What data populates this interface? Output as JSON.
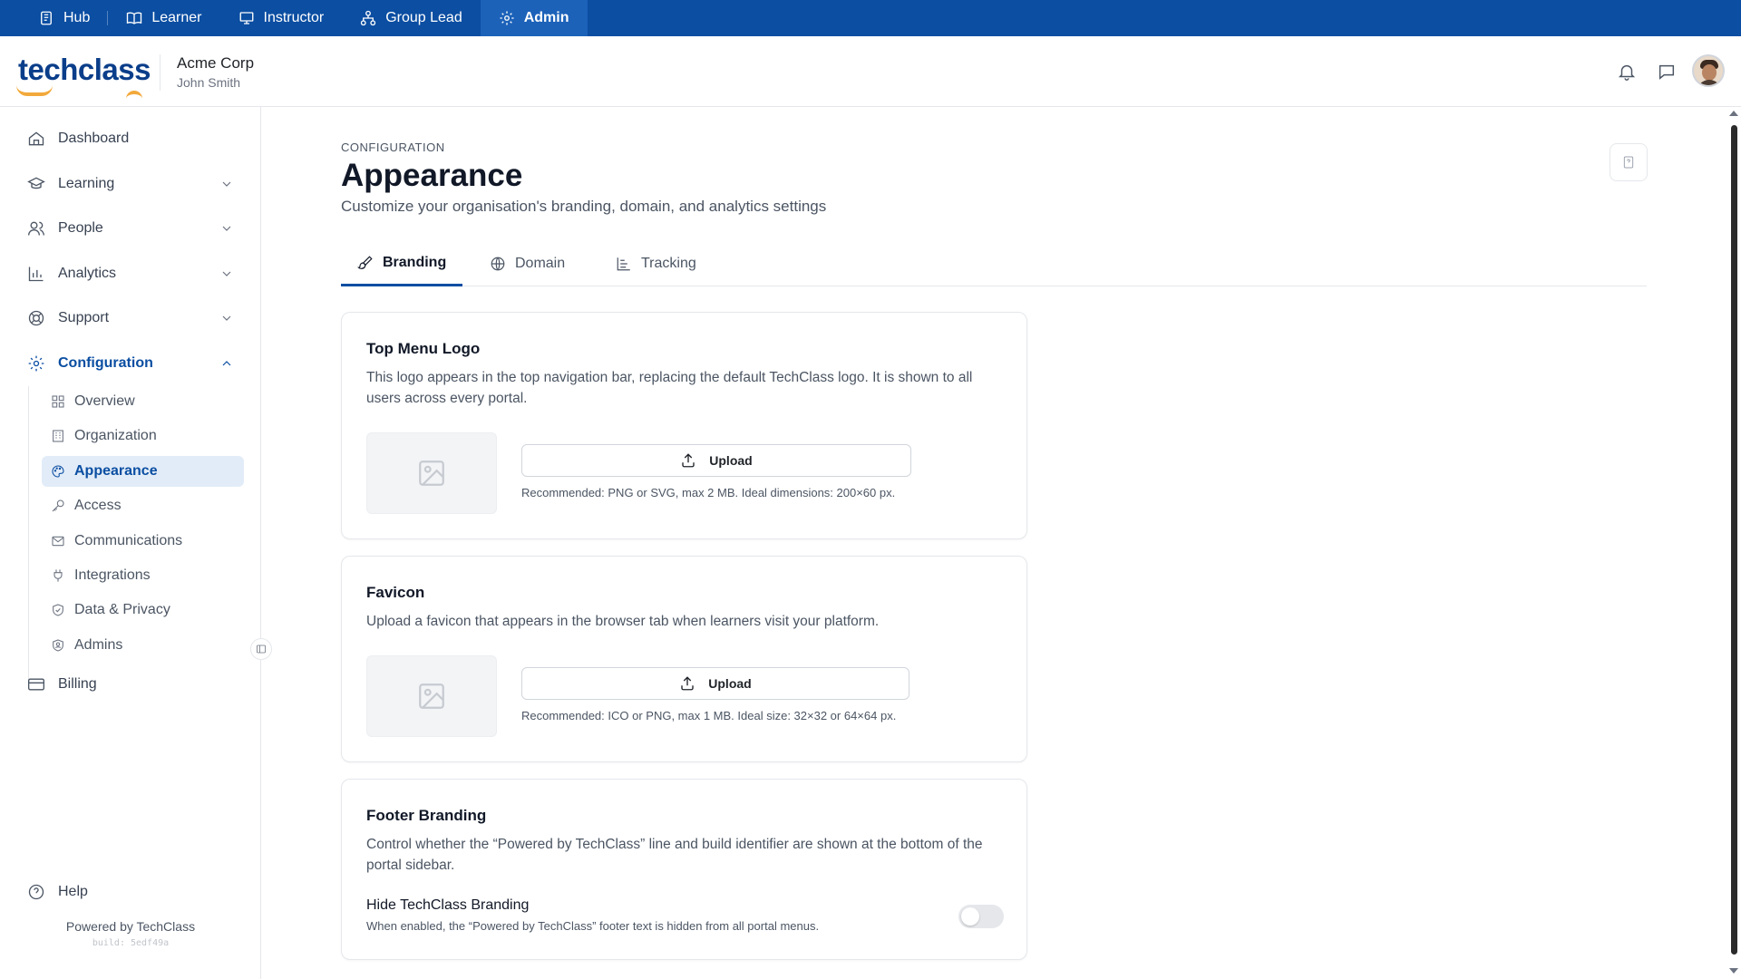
{
  "portal_tabs": [
    {
      "label": "Hub",
      "icon": "hub-icon"
    },
    {
      "label": "Learner",
      "icon": "book-icon"
    },
    {
      "label": "Instructor",
      "icon": "presentation-icon"
    },
    {
      "label": "Group Lead",
      "icon": "org-chart-icon"
    },
    {
      "label": "Admin",
      "icon": "gear-icon",
      "active": true
    }
  ],
  "header": {
    "logo_text": "techclass",
    "org_name": "Acme Corp",
    "user_name": "John Smith"
  },
  "sidebar": {
    "items": [
      {
        "label": "Dashboard",
        "icon": "home-icon"
      },
      {
        "label": "Learning",
        "icon": "graduation-cap-icon"
      },
      {
        "label": "People",
        "icon": "users-icon"
      },
      {
        "label": "Analytics",
        "icon": "bar-chart-icon"
      },
      {
        "label": "Support",
        "icon": "lifebuoy-icon"
      },
      {
        "label": "Configuration",
        "icon": "gear-icon",
        "expanded": true
      },
      {
        "label": "Billing",
        "icon": "credit-card-icon"
      },
      {
        "label": "Help",
        "icon": "help-circle-icon"
      }
    ],
    "config_sub": [
      {
        "label": "Overview",
        "icon": "grid-icon"
      },
      {
        "label": "Organization",
        "icon": "building-icon"
      },
      {
        "label": "Appearance",
        "icon": "palette-icon",
        "active": true
      },
      {
        "label": "Access",
        "icon": "key-icon"
      },
      {
        "label": "Communications",
        "icon": "mail-icon"
      },
      {
        "label": "Integrations",
        "icon": "plug-icon"
      },
      {
        "label": "Data & Privacy",
        "icon": "shield-check-icon"
      },
      {
        "label": "Admins",
        "icon": "admin-shield-icon"
      }
    ],
    "powered_by": "Powered by TechClass",
    "build": "build: 5edf49a"
  },
  "page": {
    "eyebrow": "CONFIGURATION",
    "title": "Appearance",
    "subtitle": "Customize your organisation's branding, domain, and analytics settings"
  },
  "tabs": [
    {
      "label": "Branding",
      "icon": "brush-icon",
      "active": true
    },
    {
      "label": "Domain",
      "icon": "globe-icon"
    },
    {
      "label": "Tracking",
      "icon": "chart-icon"
    }
  ],
  "cards": {
    "top_logo": {
      "title": "Top Menu Logo",
      "description": "This logo appears in the top navigation bar, replacing the default TechClass logo. It is shown to all users across every portal.",
      "upload_label": "Upload",
      "hint": "Recommended: PNG or SVG, max 2 MB. Ideal dimensions: 200×60 px."
    },
    "favicon": {
      "title": "Favicon",
      "description": "Upload a favicon that appears in the browser tab when learners visit your platform.",
      "upload_label": "Upload",
      "hint": "Recommended: ICO or PNG, max 1 MB. Ideal size: 32×32 or 64×64 px."
    },
    "footer": {
      "title": "Footer Branding",
      "description": "Control whether the “Powered by TechClass” line and build identifier are shown at the bottom of the portal sidebar.",
      "toggle_label": "Hide TechClass Branding",
      "toggle_sub": "When enabled, the “Powered by TechClass” footer text is hidden from all portal menus.",
      "toggle_on": false
    }
  },
  "colors": {
    "brand_blue": "#0b4ea2",
    "accent_orange": "#f2a93b",
    "active_bg": "#e2ecf8"
  }
}
